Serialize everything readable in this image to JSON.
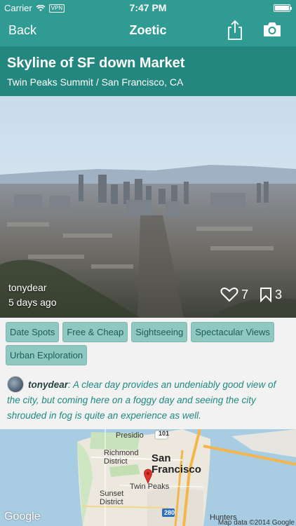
{
  "status": {
    "carrier": "Carrier",
    "vpn": "VPN",
    "time": "7:47 PM"
  },
  "nav": {
    "back_label": "Back",
    "title": "Zoetic"
  },
  "spot": {
    "title": "Skyline of SF down Market",
    "subtitle": "Twin Peaks Summit / San Francisco, CA"
  },
  "photo": {
    "user": "tonydear",
    "posted": "5 days ago",
    "likes": "7",
    "saves": "3"
  },
  "tags": [
    "Date Spots",
    "Free & Cheap",
    "Sightseeing",
    "Spectacular Views",
    "Urban Exploration"
  ],
  "comment": {
    "user": "tonydear",
    "text": ": A clear day provides an undeniably good view of the city, but coming here on a foggy day and seeing the city shrouded in fog is quite an experience as well."
  },
  "map": {
    "labels": {
      "presidio": "Presidio",
      "richmond": "Richmond District",
      "city": "San Francisco",
      "twin_peaks": "Twin Peaks",
      "sunset": "Sunset District",
      "hunters": "Hunters",
      "route_101": "101",
      "route_280": "280"
    },
    "google": "Google",
    "copyright": "Map data ©2014 Google"
  },
  "colors": {
    "nav_bg": "#2f9b93",
    "header_bg": "#24877f",
    "tag_bg": "#8fc7c1",
    "comment_text": "#1e8a82"
  },
  "icons": [
    "wifi-icon",
    "battery-icon",
    "share-icon",
    "camera-icon",
    "heart-icon",
    "bookmark-icon",
    "map-pin-icon"
  ]
}
